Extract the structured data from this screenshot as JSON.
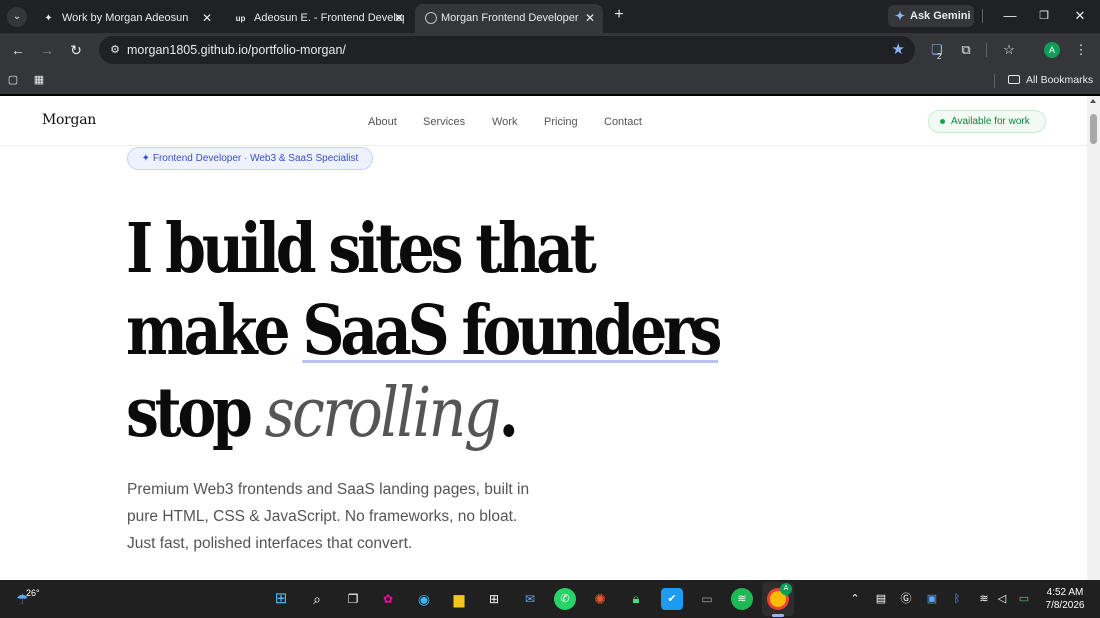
{
  "browser": {
    "tabs": [
      {
        "title": "Work by Morgan Adeosun",
        "active": false
      },
      {
        "title": "Adeosun E. - Frontend Develop",
        "active": false
      },
      {
        "title": "Morgan Frontend Developer",
        "active": true
      }
    ],
    "ask_gemini": "Ask Gemini",
    "url": "morgan1805.github.io/portfolio-morgan/",
    "all_bookmarks": "All Bookmarks",
    "extension_badge": "2",
    "profile_initial": "A"
  },
  "site": {
    "logo": "Morgan",
    "nav": [
      "About",
      "Services",
      "Work",
      "Pricing",
      "Contact"
    ],
    "availability": "Available for work",
    "badge": "✦ Frontend Developer · Web3 & SaaS Specialist",
    "hero": {
      "line1": "I build sites that",
      "line2_prefix": "make ",
      "line2_highlight": "SaaS founders",
      "line3_prefix": "stop ",
      "line3_italic": "scrolling",
      "line3_suffix": "."
    },
    "lead": "Premium Web3 frontends and SaaS landing pages, built in pure HTML, CSS & JavaScript. No frameworks, no bloat. Just fast, polished interfaces that convert."
  },
  "taskbar": {
    "temperature": "26°",
    "time": "4:52 AM",
    "date": "7/8/2026",
    "chrome_badge": "A"
  },
  "colors": {
    "accent_indigo": "#3b4fc4",
    "available_green": "#16a34a",
    "underline": "#b9c3f0"
  }
}
